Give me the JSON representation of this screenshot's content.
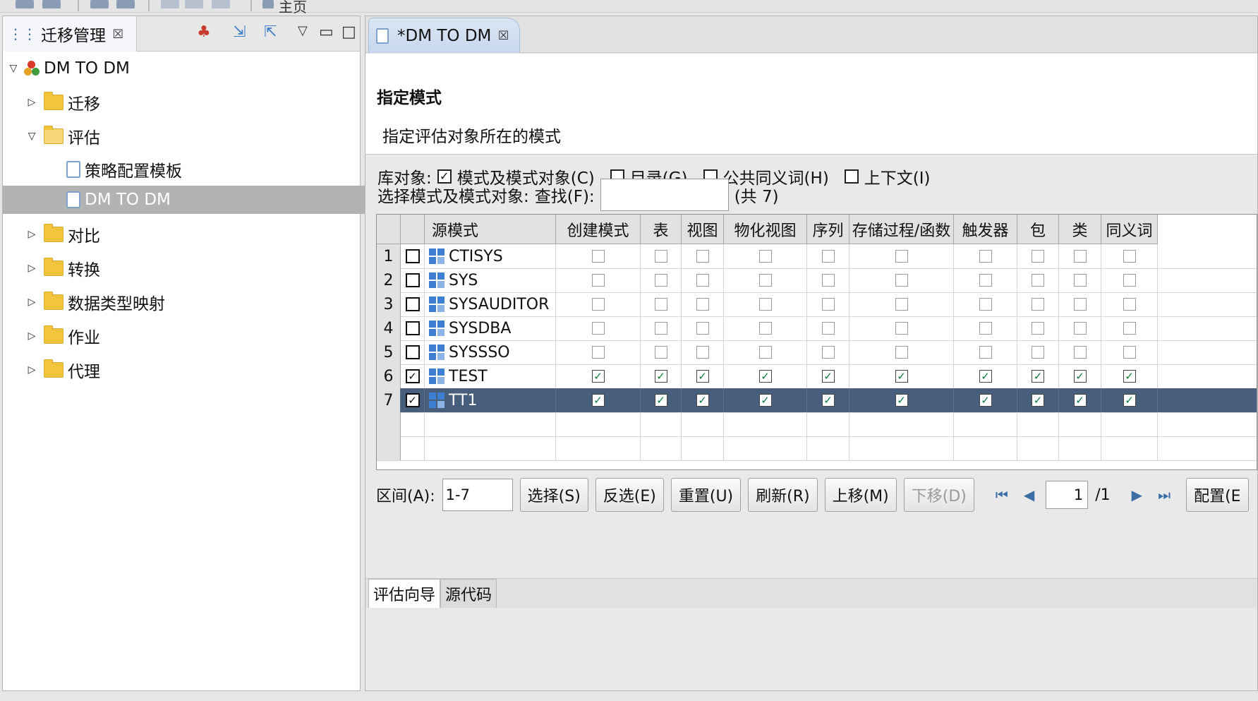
{
  "toolbar": {
    "home_label": "主页"
  },
  "left_panel": {
    "tab_title": "迁移管理",
    "tree": [
      {
        "label": "DM TO DM"
      },
      {
        "label": "迁移"
      },
      {
        "label": "评估"
      },
      {
        "label": "策略配置模板"
      },
      {
        "label": "DM TO DM"
      },
      {
        "label": "对比"
      },
      {
        "label": "转换"
      },
      {
        "label": "数据类型映射"
      },
      {
        "label": "作业"
      },
      {
        "label": "代理"
      }
    ]
  },
  "right_panel": {
    "tab_title": "*DM TO DM",
    "header": {
      "title": "指定模式",
      "description": "指定评估对象所在的模式"
    },
    "db_objects": {
      "label": "库对象:",
      "options": [
        {
          "label": "模式及模式对象(C)",
          "checked": true
        },
        {
          "label": "目录(G)",
          "checked": false
        },
        {
          "label": "公共同义词(H)",
          "checked": false
        },
        {
          "label": "上下文(I)",
          "checked": false
        }
      ]
    },
    "select": {
      "label": "选择模式及模式对象:",
      "search_label": "查找(F):",
      "search_value": "",
      "count": "(共 7)"
    },
    "grid": {
      "columns": [
        "源模式",
        "创建模式",
        "表",
        "视图",
        "物化视图",
        "序列",
        "存储过程/函数",
        "触发器",
        "包",
        "类",
        "同义词"
      ],
      "rows": [
        {
          "num": "1",
          "name": "CTISYS",
          "selected": false,
          "values": [
            false,
            false,
            false,
            false,
            false,
            false,
            false,
            false,
            false,
            false
          ]
        },
        {
          "num": "2",
          "name": "SYS",
          "selected": false,
          "values": [
            false,
            false,
            false,
            false,
            false,
            false,
            false,
            false,
            false,
            false
          ]
        },
        {
          "num": "3",
          "name": "SYSAUDITOR",
          "selected": false,
          "values": [
            false,
            false,
            false,
            false,
            false,
            false,
            false,
            false,
            false,
            false
          ]
        },
        {
          "num": "4",
          "name": "SYSDBA",
          "selected": false,
          "values": [
            false,
            false,
            false,
            false,
            false,
            false,
            false,
            false,
            false,
            false
          ]
        },
        {
          "num": "5",
          "name": "SYSSSO",
          "selected": false,
          "values": [
            false,
            false,
            false,
            false,
            false,
            false,
            false,
            false,
            false,
            false
          ]
        },
        {
          "num": "6",
          "name": "TEST",
          "selected": true,
          "values": [
            true,
            true,
            true,
            true,
            true,
            true,
            true,
            true,
            true,
            true
          ]
        },
        {
          "num": "7",
          "name": "TT1",
          "selected": true,
          "values": [
            true,
            true,
            true,
            true,
            true,
            true,
            true,
            true,
            true,
            true
          ]
        }
      ]
    },
    "controls": {
      "range_label": "区间(A):",
      "range_value": "1-7",
      "buttons": [
        "选择(S)",
        "反选(E)",
        "重置(U)",
        "刷新(R)",
        "上移(M)",
        "下移(D)"
      ],
      "page_value": "1",
      "page_total": "/1",
      "config_label": "配置(E"
    },
    "bottom_tabs": [
      "评估向导",
      "源代码"
    ]
  },
  "colors": {
    "selection_row": "#475e7d",
    "tree_selection": "#b3b3b3",
    "folder": "#f2c53d",
    "check": "#0a7a3a"
  }
}
